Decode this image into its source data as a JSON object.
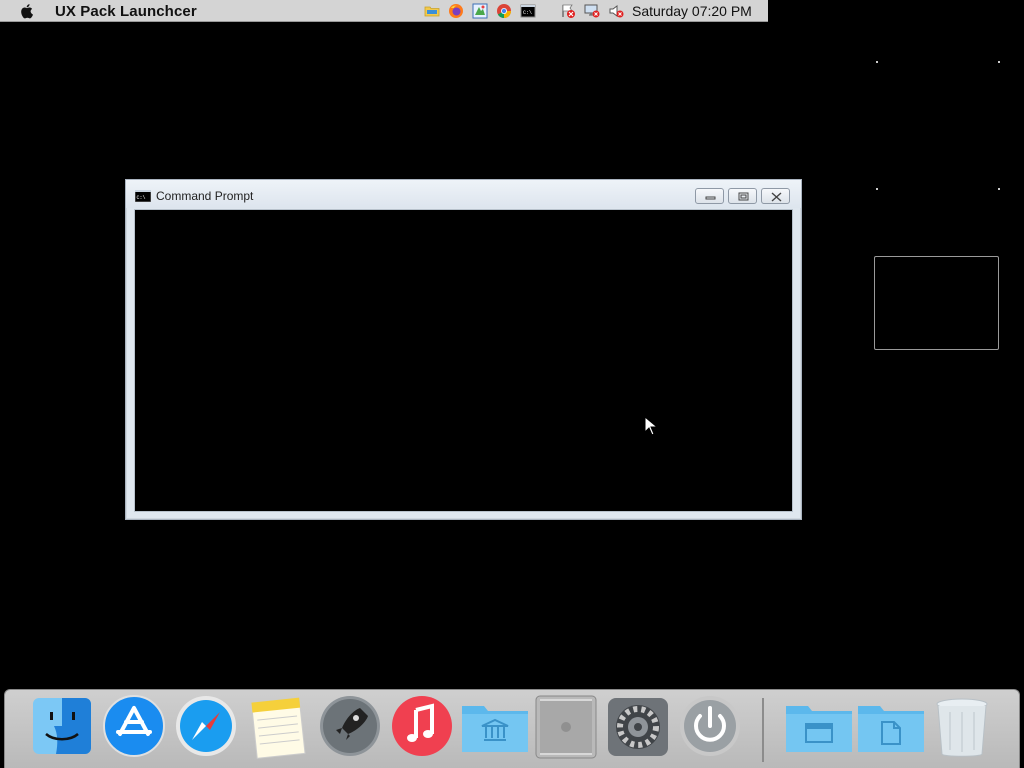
{
  "menubar": {
    "app_title": "UX Pack Launchcer",
    "clock": "Saturday 07:20 PM",
    "tray_icons": [
      "folder-icon",
      "firefox-icon",
      "paint-icon",
      "chrome-icon",
      "cmd-icon",
      "flag-error-icon",
      "network-error-icon",
      "volume-muted-icon"
    ]
  },
  "cmd_window": {
    "title": "Command Prompt",
    "buttons": [
      "minimize",
      "restore",
      "close"
    ]
  },
  "dock": {
    "items": [
      "finder-icon",
      "app-store-icon",
      "safari-icon",
      "notes-icon",
      "launchpad-icon",
      "music-icon",
      "applications-folder-icon",
      "mac-pro-icon",
      "system-preferences-icon",
      "power-icon",
      "documents-folder-icon",
      "files-folder-icon",
      "trash-icon"
    ]
  },
  "colors": {
    "menubar": "#d4d4d4",
    "window_frame": "#dfe7ef",
    "folder_blue": "#5cb8ec",
    "music_red": "#f04050"
  }
}
